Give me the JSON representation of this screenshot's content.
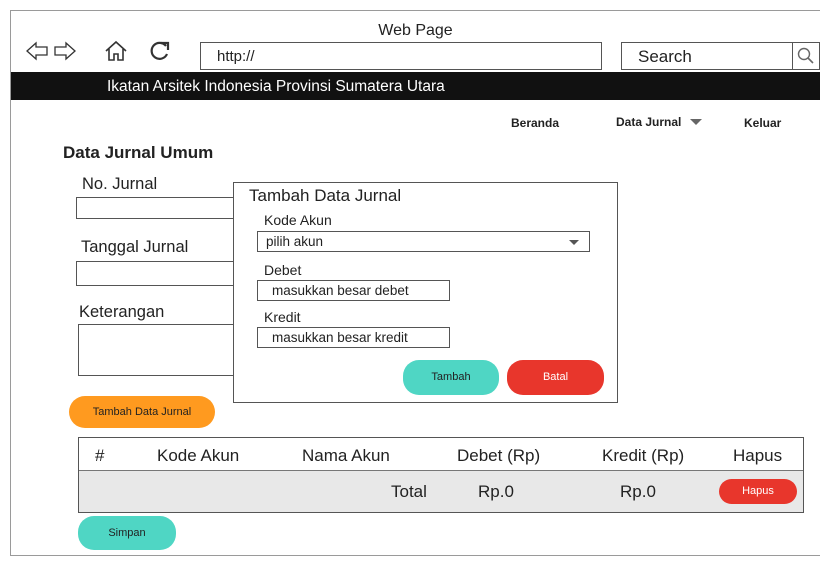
{
  "browser": {
    "title": "Web Page",
    "url": "http://",
    "search_placeholder": "Search"
  },
  "site": {
    "banner": "Ikatan Arsitek Indonesia Provinsi Sumatera Utara"
  },
  "nav": {
    "home": "Beranda",
    "journal": "Data Jurnal",
    "logout": "Keluar"
  },
  "page": {
    "title": "Data Jurnal Umum",
    "no_jurnal_label": "No. Jurnal",
    "tanggal_label": "Tanggal Jurnal",
    "keterangan_label": "Keterangan",
    "add_button": "Tambah Data Jurnal",
    "save_button": "Simpan"
  },
  "modal": {
    "title": "Tambah Data Jurnal",
    "kode_akun_label": "Kode Akun",
    "kode_akun_value": "pilih akun",
    "debet_label": "Debet",
    "debet_placeholder": "masukkan besar debet",
    "kredit_label": "Kredit",
    "kredit_placeholder": "masukkan besar kredit",
    "submit_button": "Tambah",
    "cancel_button": "Batal"
  },
  "table": {
    "headers": [
      "#",
      "Kode Akun",
      "Nama Akun",
      "Debet (Rp)",
      "Kredit (Rp)",
      "Hapus"
    ],
    "total_label": "Total",
    "total_debet": "Rp.0",
    "total_kredit": "Rp.0",
    "delete_button": "Hapus"
  },
  "colors": {
    "orange": "#ff9a1f",
    "teal": "#4fd6c4",
    "red": "#e8362c",
    "banner": "#111111"
  }
}
